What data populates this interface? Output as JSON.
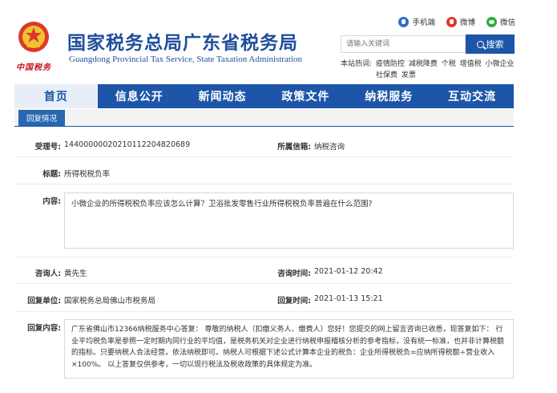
{
  "header": {
    "title": "国家税务总局广东省税务局",
    "subtitle": "Guangdong Provincial Tax Service, State Taxation Administration",
    "seal_text": "中国税务"
  },
  "social": [
    {
      "label": "手机端",
      "icon": "mobile-icon"
    },
    {
      "label": "微博",
      "icon": "weibo-icon"
    },
    {
      "label": "微信",
      "icon": "wechat-icon"
    }
  ],
  "search": {
    "placeholder": "请输入关键词",
    "button_label": "搜索"
  },
  "hot": {
    "prefix": "本站热词:",
    "words_line1": [
      "疫情防控",
      "减税降费",
      "个税",
      "增值税",
      "小微企业"
    ],
    "words_line2": [
      "社保费",
      "发票"
    ]
  },
  "nav": [
    {
      "label": "首页",
      "active": true
    },
    {
      "label": "信息公开",
      "active": false
    },
    {
      "label": "新闻动态",
      "active": false
    },
    {
      "label": "政策文件",
      "active": false
    },
    {
      "label": "纳税服务",
      "active": false
    },
    {
      "label": "互动交流",
      "active": false
    }
  ],
  "tab": {
    "label": "回复情况"
  },
  "detail": {
    "accept_no_label": "受理号:",
    "accept_no": "14400000020210112204820689",
    "category_label": "所属信箱:",
    "category": "纳税咨询",
    "subject_label": "标题:",
    "subject": "所得税税负率",
    "content_label": "内容:",
    "content": "小微企业的所得税税负率应该怎么计算？卫浴批发零售行业所得税税负率普遍在什么范围?",
    "asker_label": "咨询人:",
    "asker": "黄先生",
    "ask_time_label": "咨询时间:",
    "ask_time": "2021-01-12 20:42",
    "reply_unit_label": "回复单位:",
    "reply_unit": "国家税务总局佛山市税务局",
    "reply_time_label": "回复时间:",
    "reply_time": "2021-01-13 15:21",
    "reply_content_label": "回复内容:",
    "reply_content": "广东省佛山市12366纳税服务中心答复： 尊敬的纳税人（扣缴义务人、缴费人）您好！您提交的网上留言咨询已收悉，现答复如下： 行业平均税负率是参照一定时期内同行业的平均值，是税务机关对企业进行纳税申报稽核分析的参考指标，没有统一标准，也并非计算税额的指标。只要纳税人合法经营，依法纳税即可。纳税人可根据下述公式计算本企业的税负：企业所得税税负=应纳所得税额÷营业收入×100%。 以上答复仅供参考，一切以现行税法及税收政策的具体规定为准。"
  },
  "colors": {
    "brand_blue": "#1d56a8",
    "seal_red": "#c8161d"
  }
}
